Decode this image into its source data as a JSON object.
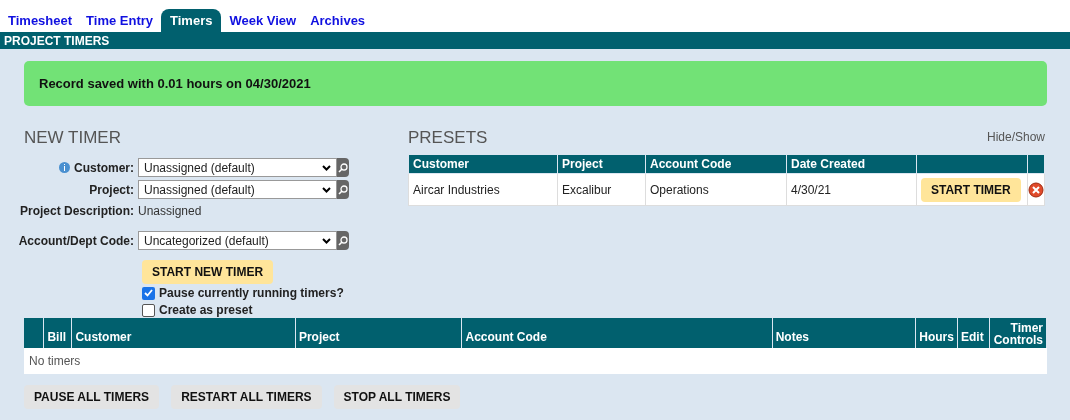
{
  "tabs": [
    {
      "label": "Timesheet",
      "selected": false
    },
    {
      "label": "Time Entry",
      "selected": false
    },
    {
      "label": "Timers",
      "selected": true
    },
    {
      "label": "Week View",
      "selected": false
    },
    {
      "label": "Archives",
      "selected": false
    }
  ],
  "section_title": "PROJECT TIMERS",
  "alert": "Record saved with 0.01 hours on 04/30/2021",
  "new_timer": {
    "title": "NEW TIMER",
    "fields": [
      {
        "kind": "select",
        "label": "Customer:",
        "info": true,
        "value": "Unassigned (default)"
      },
      {
        "kind": "select",
        "label": "Project:",
        "info": false,
        "value": "Unassigned (default)"
      },
      {
        "kind": "text",
        "label": "Project Description:",
        "info": false,
        "value": "Unassigned"
      },
      {
        "kind": "select",
        "label": "Account/Dept Code:",
        "info": false,
        "value": "Uncategorized (default)"
      }
    ],
    "button": "START NEW TIMER",
    "checkboxes": [
      {
        "label": "Pause currently running timers?",
        "checked": true
      },
      {
        "label": "Create as preset",
        "checked": false
      }
    ]
  },
  "presets": {
    "title": "PRESETS",
    "toggle_link": "Hide/Show",
    "columns": [
      "Customer",
      "Project",
      "Account Code",
      "Date Created"
    ],
    "rows": [
      {
        "cells": [
          "Aircar Industries",
          "Excalibur",
          "Operations",
          "4/30/21"
        ],
        "button": "START TIMER"
      }
    ]
  },
  "timers": {
    "columns": [
      "Bill",
      "Customer",
      "Project",
      "Account Code",
      "Notes",
      "Hours",
      "Edit",
      "Timer Controls"
    ],
    "empty_text": "No timers"
  },
  "actions": [
    "PAUSE ALL TIMERS",
    "RESTART ALL TIMERS",
    "STOP ALL TIMERS"
  ]
}
